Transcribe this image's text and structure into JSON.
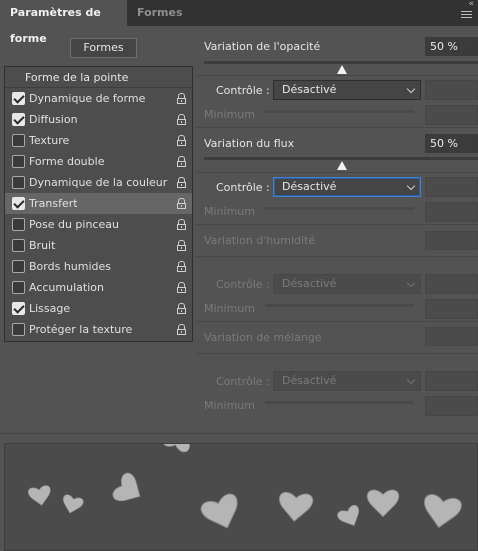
{
  "tabs": [
    {
      "label": "Paramètres de forme",
      "active": true
    },
    {
      "label": "Formes",
      "active": false
    }
  ],
  "formes_button": "Formes",
  "list": {
    "header": "Forme de la pointe",
    "items": [
      {
        "label": "Dynamique de forme",
        "checked": true
      },
      {
        "label": "Diffusion",
        "checked": true
      },
      {
        "label": "Texture",
        "checked": false
      },
      {
        "label": "Forme double",
        "checked": false
      },
      {
        "label": "Dynamique de la couleur",
        "checked": false
      },
      {
        "label": "Transfert",
        "checked": true,
        "selected": true
      },
      {
        "label": "Pose du pinceau",
        "checked": false
      },
      {
        "label": "Bruit",
        "checked": false
      },
      {
        "label": "Bords humides",
        "checked": false
      },
      {
        "label": "Accumulation",
        "checked": false
      },
      {
        "label": "Lissage",
        "checked": true
      },
      {
        "label": "Protéger la texture",
        "checked": false
      }
    ]
  },
  "settings": {
    "opacity": {
      "label": "Variation de l'opacité",
      "value": "50 %",
      "slider_percent": 50
    },
    "opacity_control": {
      "label": "Contrôle :",
      "value": "Désactivé"
    },
    "opacity_min": {
      "label": "Minimum"
    },
    "flow": {
      "label": "Variation du flux",
      "value": "50 %",
      "slider_percent": 50
    },
    "flow_control": {
      "label": "Contrôle :",
      "value": "Désactivé"
    },
    "flow_min": {
      "label": "Minimum"
    },
    "wetness": {
      "label": "Variation d'humidité"
    },
    "wetness_control": {
      "label": "Contrôle :",
      "value": "Désactivé"
    },
    "wetness_min": {
      "label": "Minimum"
    },
    "mix": {
      "label": "Variation de mélange"
    },
    "mix_control": {
      "label": "Contrôle :",
      "value": "Désactivé"
    },
    "mix_min": {
      "label": "Minimum"
    }
  },
  "colors": {
    "panel_bg": "#535353",
    "tabbar_bg": "#323232",
    "selected_row": "#666666",
    "focus_border": "#3f7fd6"
  },
  "icons": [
    "collapse-icon",
    "panel-menu-icon",
    "lock-icon",
    "chevron-down-icon",
    "checkbox-icon"
  ]
}
